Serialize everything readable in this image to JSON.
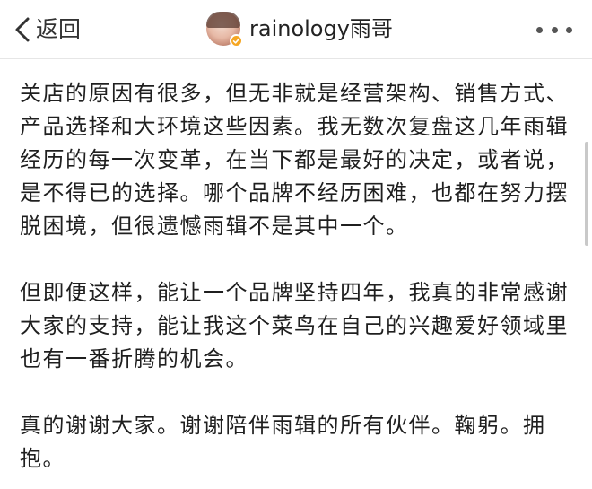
{
  "nav": {
    "back_label": "返回",
    "username": "rainology雨哥",
    "badge_color": "#f5a623",
    "icons": [
      "chevron-left-icon",
      "avatar",
      "verified-badge-icon",
      "more-icon"
    ]
  },
  "post": {
    "paragraphs": [
      "关店的原因有很多，但无非就是经营架构、销售方式、产品选择和大环境这些因素。我无数次复盘这几年雨辑经历的每一次变革，在当下都是最好的决定，或者说，是不得已的选择。哪个品牌不经历困难，也都在努力摆脱困境，但很遗憾雨辑不是其中一个。",
      "但即便这样，能让一个品牌坚持四年，我真的非常感谢大家的支持，能让我这个菜鸟在自己的兴趣爱好领域里也有一番折腾的机会。",
      "真的谢谢大家。谢谢陪伴雨辑的所有伙伴。鞠躬。拥抱。"
    ]
  }
}
